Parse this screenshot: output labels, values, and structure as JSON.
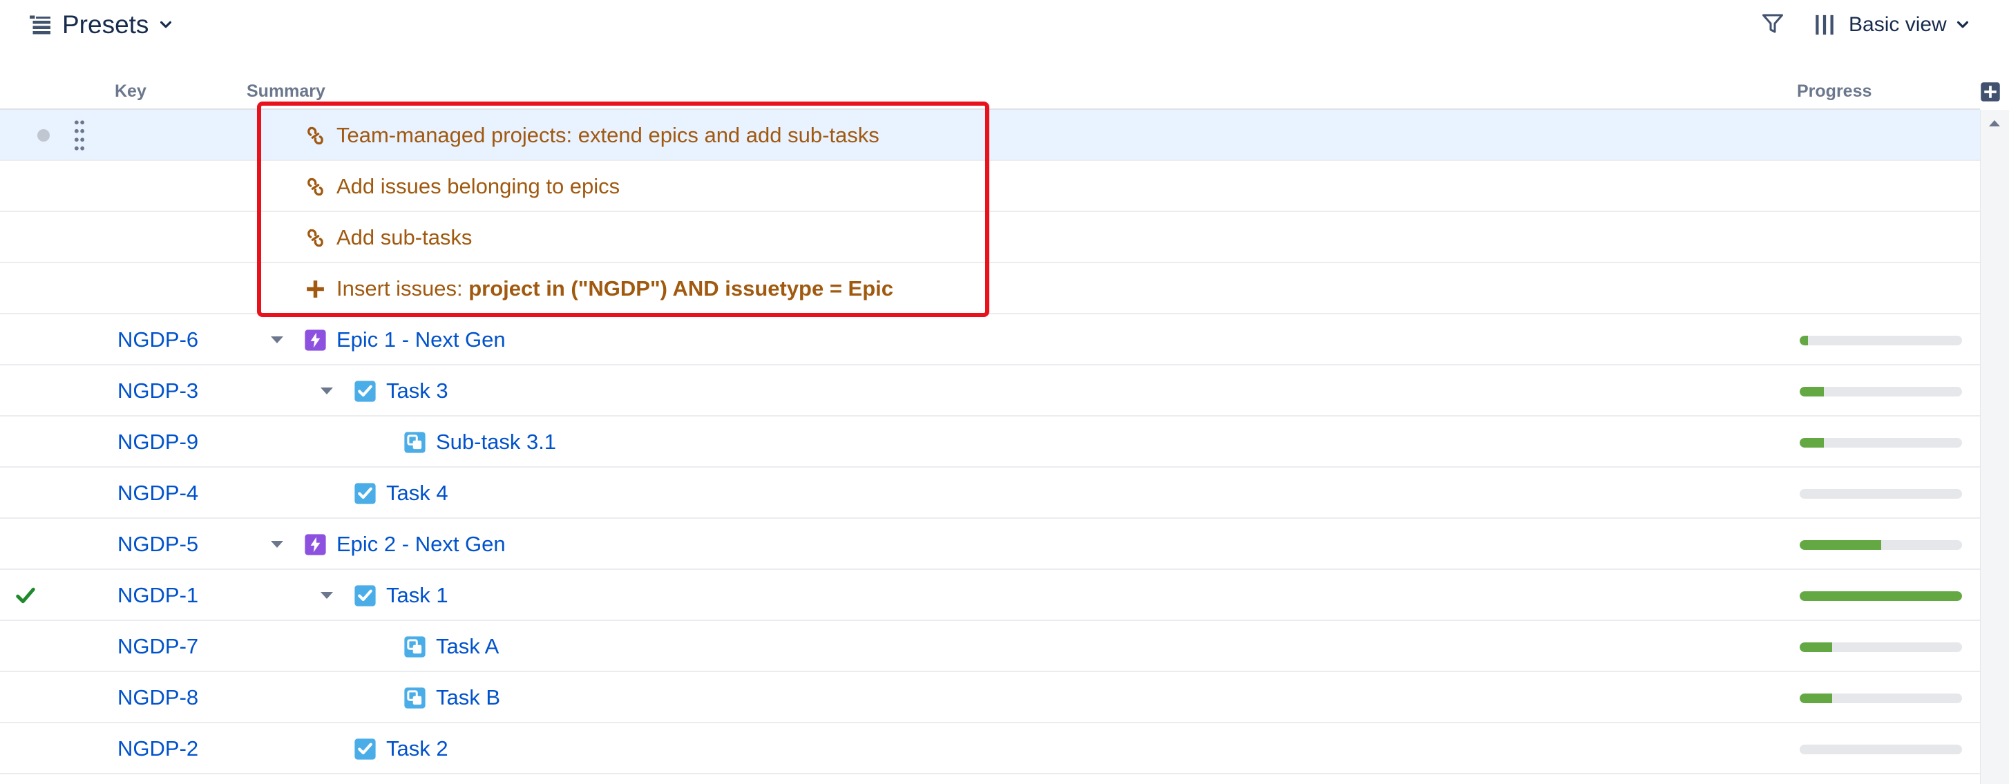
{
  "toolbar": {
    "presets_label": "Presets",
    "view_label": "Basic view"
  },
  "columns": {
    "key": "Key",
    "summary": "Summary",
    "progress": "Progress"
  },
  "generators": [
    {
      "kind": "link",
      "label": "Team-managed projects: extend epics and add sub-tasks"
    },
    {
      "kind": "link",
      "label": "Add issues belonging to epics"
    },
    {
      "kind": "link",
      "label": "Add sub-tasks"
    },
    {
      "kind": "insert",
      "label": "Insert issues: ",
      "query": "project in (\"NGDP\") AND issuetype = Epic"
    }
  ],
  "issues": [
    {
      "key": "NGDP-6",
      "type": "epic",
      "summary": "Epic 1 - Next Gen",
      "level": 0,
      "expanded": true,
      "progress": 0.05,
      "resolved": false
    },
    {
      "key": "NGDP-3",
      "type": "task",
      "summary": "Task 3",
      "level": 1,
      "expanded": true,
      "progress": 0.15,
      "resolved": false
    },
    {
      "key": "NGDP-9",
      "type": "subtask",
      "summary": "Sub-task 3.1",
      "level": 2,
      "expanded": false,
      "progress": 0.15,
      "resolved": false
    },
    {
      "key": "NGDP-4",
      "type": "task",
      "summary": "Task 4",
      "level": 1,
      "expanded": false,
      "progress": 0.0,
      "resolved": false
    },
    {
      "key": "NGDP-5",
      "type": "epic",
      "summary": "Epic 2 - Next Gen",
      "level": 0,
      "expanded": true,
      "progress": 0.5,
      "resolved": false
    },
    {
      "key": "NGDP-1",
      "type": "task",
      "summary": "Task 1",
      "level": 1,
      "expanded": true,
      "progress": 1.0,
      "resolved": true
    },
    {
      "key": "NGDP-7",
      "type": "subtask",
      "summary": "Task A",
      "level": 2,
      "expanded": false,
      "progress": 0.2,
      "resolved": false
    },
    {
      "key": "NGDP-8",
      "type": "subtask",
      "summary": "Task B",
      "level": 2,
      "expanded": false,
      "progress": 0.2,
      "resolved": false
    },
    {
      "key": "NGDP-2",
      "type": "task",
      "summary": "Task 2",
      "level": 1,
      "expanded": false,
      "progress": 0.0,
      "resolved": false
    }
  ],
  "colors": {
    "link": "#0052cc",
    "generator": "#a0590f",
    "progress_fill": "#64a844",
    "epic": "#8d51e0",
    "task": "#4bade8",
    "highlight": "#e8111c"
  }
}
